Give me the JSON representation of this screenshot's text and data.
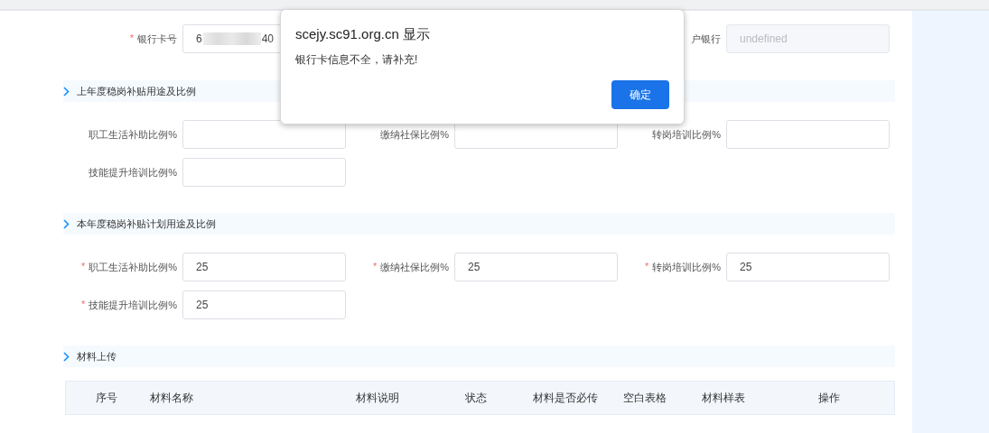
{
  "bank_row": {
    "fields": [
      {
        "label": "银行卡号",
        "required_mark": "*",
        "value_parts": [
          "6",
          "40"
        ],
        "masked": true,
        "disabled": false
      },
      {
        "label": "户银行",
        "value_parts": [
          "undefined"
        ],
        "disabled": true
      }
    ]
  },
  "sections": [
    {
      "title": "上年度稳岗补贴用途及比例",
      "fields": [
        {
          "label": "职工生活补助比例%"
        },
        {
          "label": "缴纳社保比例%"
        },
        {
          "label": "转岗培训比例%"
        },
        {
          "label": "技能提升培训比例%"
        }
      ]
    },
    {
      "title": "本年度稳岗补贴计划用途及比例",
      "fields": [
        {
          "label": "职工生活补助比例%",
          "required_mark": "*",
          "value": "25"
        },
        {
          "label": "缴纳社保比例%",
          "required_mark": "*",
          "value": "25"
        },
        {
          "label": "转岗培训比例%",
          "required_mark": "*",
          "value": "25"
        },
        {
          "label": "技能提升培训比例%",
          "required_mark": "*",
          "value": "25"
        }
      ]
    },
    {
      "title": "材料上传",
      "table": {
        "columns": [
          "序号",
          "材料名称",
          "材料说明",
          "状态",
          "材料是否必传",
          "空白表格",
          "材料样表",
          "操作"
        ]
      }
    }
  ],
  "dialog": {
    "title": "scejy.sc91.org.cn 显示",
    "message": "银行卡信息不全，请补充!",
    "buttons": [
      "确定"
    ]
  }
}
